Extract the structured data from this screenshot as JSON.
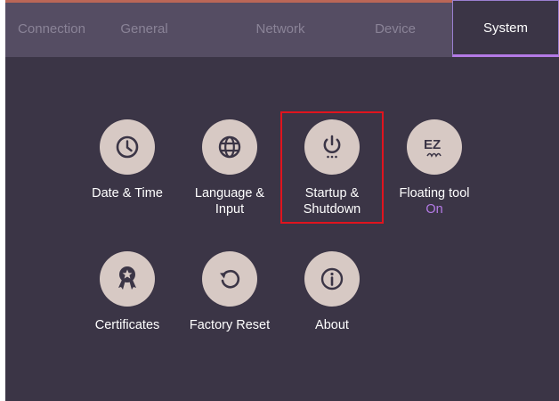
{
  "tabs": [
    {
      "label": "Connection"
    },
    {
      "label": "General"
    },
    {
      "label": "Network"
    },
    {
      "label": "Device"
    },
    {
      "label": "System",
      "active": true
    }
  ],
  "items": [
    {
      "id": "date-time",
      "icon": "clock-icon",
      "label_lines": [
        "Date & Time"
      ]
    },
    {
      "id": "language-input",
      "icon": "globe-icon",
      "label_lines": [
        "Language &",
        "Input"
      ]
    },
    {
      "id": "startup-shutdown",
      "icon": "power-icon",
      "label_lines": [
        "Startup &",
        "Shutdown"
      ],
      "highlighted": true
    },
    {
      "id": "floating-tool",
      "icon": "ez-write-icon",
      "label_lines": [
        "Floating tool"
      ],
      "status": "On"
    },
    {
      "id": "certificates",
      "icon": "award-ribbon-icon",
      "label_lines": [
        "Certificates"
      ]
    },
    {
      "id": "factory-reset",
      "icon": "reset-icon",
      "label_lines": [
        "Factory Reset"
      ]
    },
    {
      "id": "about",
      "icon": "info-icon",
      "label_lines": [
        "About"
      ]
    }
  ],
  "colors": {
    "background": "#3b3546",
    "tabbar": "#554d63",
    "accent": "#b47ae6",
    "icon_circle": "#d7c9c4",
    "icon_glyph": "#3b3546",
    "highlight_box": "#e0141e"
  }
}
